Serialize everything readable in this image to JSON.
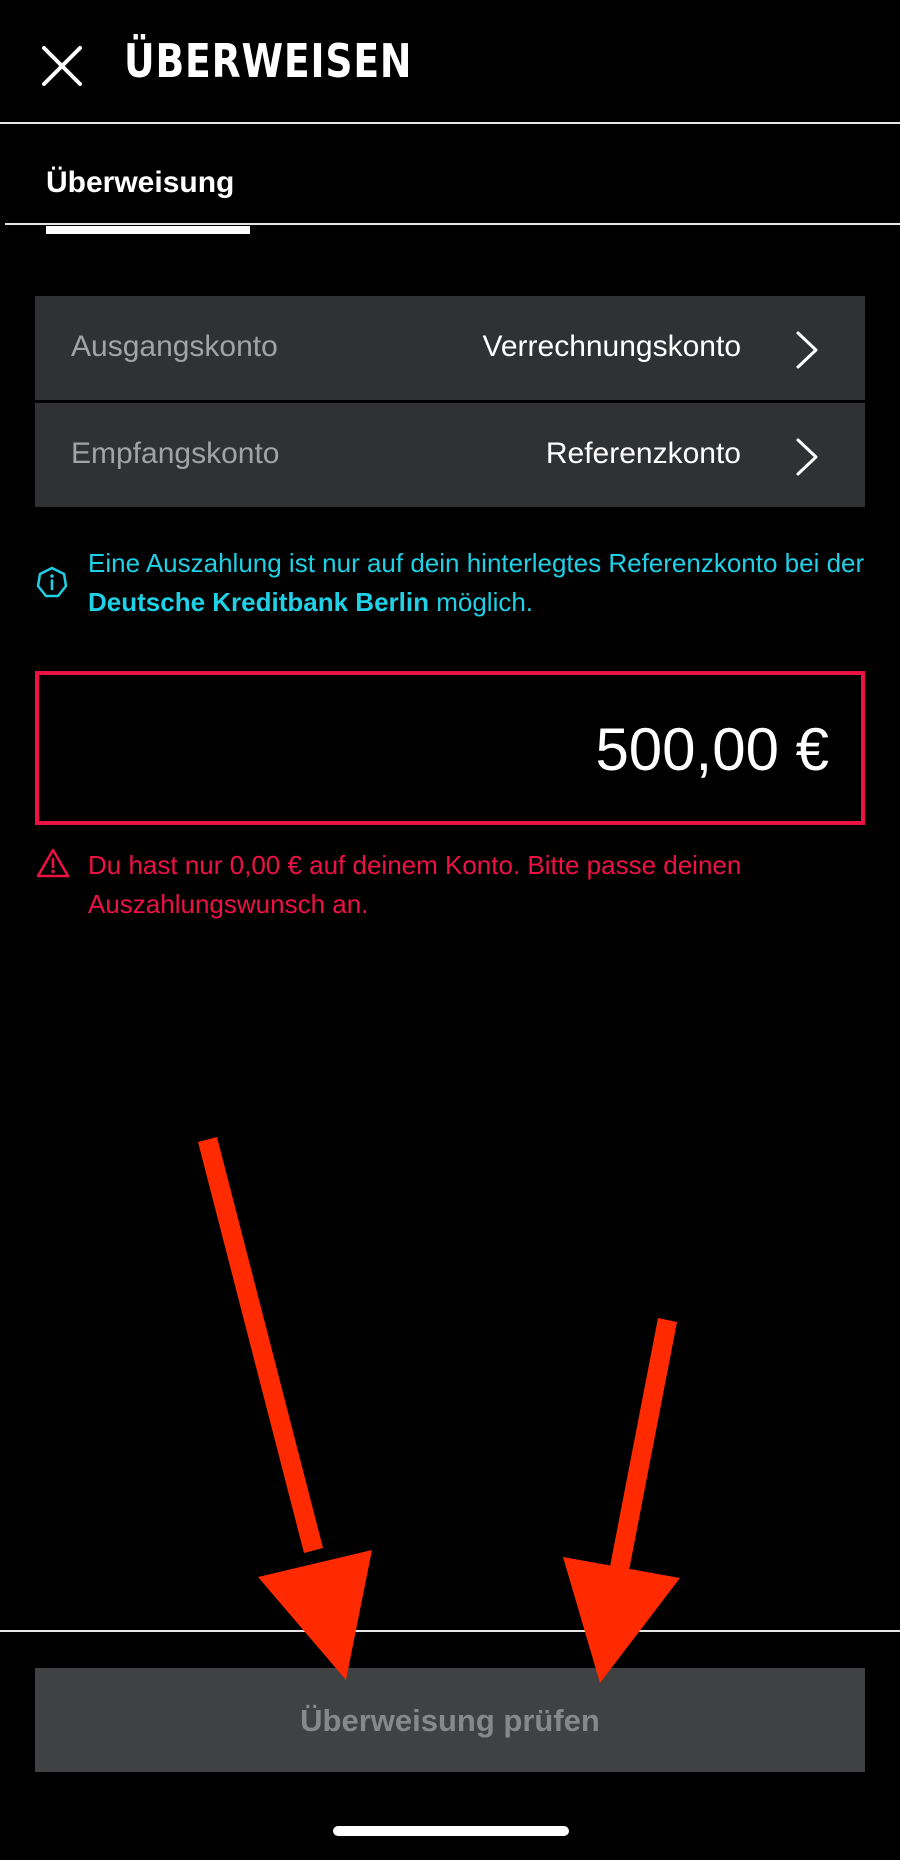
{
  "header": {
    "title": "ÜBERWEISEN",
    "close_icon": "close-icon"
  },
  "tabs": [
    {
      "label": "Überweisung",
      "active": true
    }
  ],
  "accounts": [
    {
      "label": "Ausgangskonto",
      "value": "Verrechnungskonto",
      "icon": "chevron-right-icon"
    },
    {
      "label": "Empfangskonto",
      "value": "Referenzkonto",
      "icon": "chevron-right-icon"
    }
  ],
  "info": {
    "icon": "info-icon",
    "text_before": "Eine Auszahlung ist nur auf dein hinterlegtes Referenzkonto bei der ",
    "bank": "Deutsche Kreditbank Berlin",
    "text_after": " möglich."
  },
  "amount": {
    "value": "500,00 €"
  },
  "warning": {
    "icon": "warning-icon",
    "text": "Du hast nur 0,00 € auf deinem Konto. Bitte passe deinen Auszahlungswunsch an."
  },
  "cta": {
    "label": "Überweisung prüfen",
    "enabled": false
  },
  "colors": {
    "background": "#000000",
    "row_background": "#303133",
    "info": "#1fd0e6",
    "error": "#ee1144",
    "button_disabled": "#404142",
    "annotation_arrow": "#ff2a00"
  }
}
